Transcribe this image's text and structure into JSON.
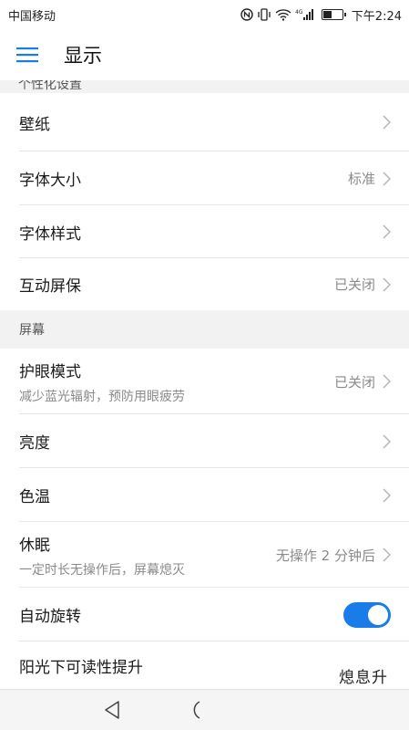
{
  "status_bar": {
    "carrier": "中国移动",
    "network": "4G",
    "time": "下午2:24"
  },
  "app_bar": {
    "title": "显示",
    "menu_icon": "menu-icon"
  },
  "partial_section": {
    "label": "个性化设置"
  },
  "personalization_rows": [
    {
      "title": "壁纸",
      "value": ""
    },
    {
      "title": "字体大小",
      "value": "标准"
    },
    {
      "title": "字体样式",
      "value": ""
    },
    {
      "title": "互动屏保",
      "value": "已关闭"
    }
  ],
  "screen_section": {
    "label": "屏幕"
  },
  "screen_rows": [
    {
      "title": "护眼模式",
      "subtitle": "减少蓝光辐射，预防用眼疲劳",
      "value": "已关闭"
    },
    {
      "title": "亮度",
      "value": ""
    },
    {
      "title": "色温",
      "value": ""
    },
    {
      "title": "休眠",
      "subtitle": "一定时长无操作后，屏幕熄灭",
      "value": "无操作 2 分钟后"
    },
    {
      "title": "自动旋转",
      "toggle_on": true
    },
    {
      "title": "阳光下可读性提升"
    }
  ],
  "watermark": "熄息升",
  "colors": {
    "accent": "#1a7ce8",
    "section_bg": "#f2f2f2"
  }
}
